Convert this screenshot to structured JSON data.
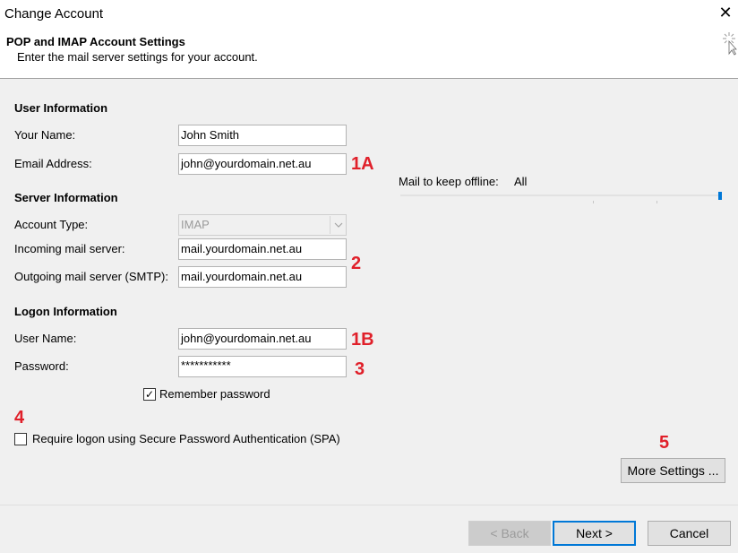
{
  "window": {
    "title": "Change Account",
    "close_glyph": "✕"
  },
  "header": {
    "heading": "POP and IMAP Account Settings",
    "subheading": "Enter the mail server settings for your account."
  },
  "user_info": {
    "section": "User Information",
    "name_label": "Your Name:",
    "name_value": "John Smith",
    "email_label": "Email Address:",
    "email_value": "john@yourdomain.net.au"
  },
  "server_info": {
    "section": "Server Information",
    "account_type_label": "Account Type:",
    "account_type_value": "IMAP",
    "incoming_label": "Incoming mail server:",
    "incoming_value": "mail.yourdomain.net.au",
    "outgoing_label": "Outgoing mail server (SMTP):",
    "outgoing_value": "mail.yourdomain.net.au"
  },
  "logon_info": {
    "section": "Logon Information",
    "username_label": "User Name:",
    "username_value": "john@yourdomain.net.au",
    "password_label": "Password:",
    "password_value": "***********",
    "remember_label": "Remember password",
    "remember_checked": true,
    "remember_glyph": "✓",
    "spa_label": "Require logon using Secure Password Authentication (SPA)",
    "spa_checked": false
  },
  "offline": {
    "label": "Mail to keep offline:",
    "value": "All",
    "slider_fraction": 1.0
  },
  "annotations": {
    "a1": "1A",
    "a2": "2",
    "a3": "1B",
    "a4": "3",
    "a5": "4",
    "a6": "5"
  },
  "buttons": {
    "more_settings": "More Settings ...",
    "back": "< Back",
    "next": "Next >",
    "cancel": "Cancel"
  },
  "colors": {
    "annotation": "#e0202a",
    "accent": "#0078d7"
  }
}
